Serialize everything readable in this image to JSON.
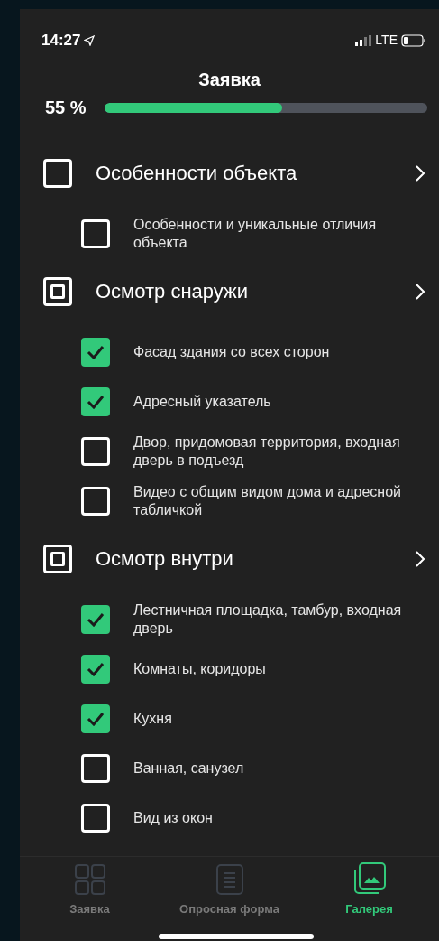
{
  "status_bar": {
    "time": "14:27",
    "network": "LTE"
  },
  "title": "Заявка",
  "progress": {
    "reading": "55 %",
    "level": 0.55
  },
  "sections": [
    {
      "title": "Особенности объекта",
      "partial": false,
      "items": [
        {
          "label": "Особенности и уникальные отличия объекта",
          "checked": false
        }
      ]
    },
    {
      "title": "Осмотр снаружи",
      "partial": true,
      "items": [
        {
          "label": "Фасад здания со всех сторон",
          "checked": true
        },
        {
          "label": "Адресный указатель",
          "checked": true
        },
        {
          "label": "Двор, придомовая территория, входная дверь в подъезд",
          "checked": false
        },
        {
          "label": "Видео с общим видом дома и адресной табличкой",
          "checked": false
        }
      ]
    },
    {
      "title": "Осмотр внутри",
      "partial": true,
      "items": [
        {
          "label": "Лестничная площадка, тамбур, входная дверь",
          "checked": true
        },
        {
          "label": "Комнаты, коридоры",
          "checked": true
        },
        {
          "label": "Кухня",
          "checked": true
        },
        {
          "label": "Ванная, санузел",
          "checked": false
        },
        {
          "label": "Вид из окон",
          "checked": false
        }
      ]
    }
  ],
  "tab_bar": [
    {
      "label": "Заявка",
      "kind": "grid",
      "selected": false
    },
    {
      "label": "Опросная форма",
      "kind": "document",
      "selected": false
    },
    {
      "label": "Галерея",
      "kind": "gallery",
      "selected": true
    }
  ]
}
